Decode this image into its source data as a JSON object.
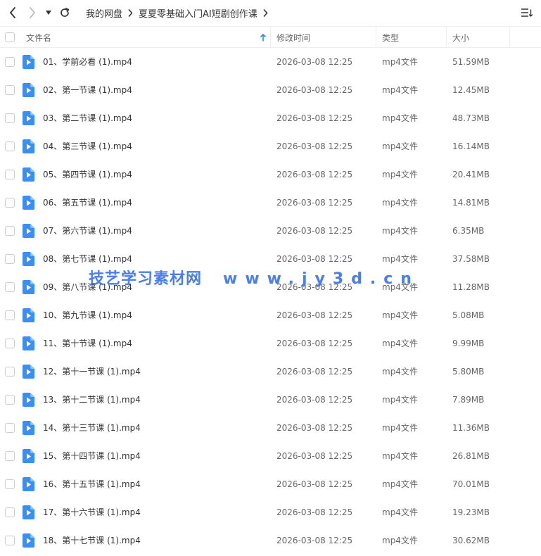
{
  "breadcrumb": {
    "items": [
      "我的网盘",
      "夏夏零基础入门AI短剧创作课"
    ]
  },
  "table": {
    "headers": {
      "name": "文件名",
      "modified": "修改时间",
      "type": "类型",
      "size": "大小"
    },
    "sort_icon": "sort-up-arrow-icon",
    "rows": [
      {
        "name": "01、学前必看 (1).mp4",
        "modified": "2026-03-08 12:25",
        "type": "mp4文件",
        "size": "51.59MB"
      },
      {
        "name": "02、第一节课 (1).mp4",
        "modified": "2026-03-08 12:25",
        "type": "mp4文件",
        "size": "12.45MB"
      },
      {
        "name": "03、第二节课 (1).mp4",
        "modified": "2026-03-08 12:25",
        "type": "mp4文件",
        "size": "48.73MB"
      },
      {
        "name": "04、第三节课 (1).mp4",
        "modified": "2026-03-08 12:25",
        "type": "mp4文件",
        "size": "16.14MB"
      },
      {
        "name": "05、第四节课 (1).mp4",
        "modified": "2026-03-08 12:25",
        "type": "mp4文件",
        "size": "20.41MB"
      },
      {
        "name": "06、第五节课 (1).mp4",
        "modified": "2026-03-08 12:25",
        "type": "mp4文件",
        "size": "14.81MB"
      },
      {
        "name": "07、第六节课 (1).mp4",
        "modified": "2026-03-08 12:25",
        "type": "mp4文件",
        "size": "6.35MB"
      },
      {
        "name": "08、第七节课 (1).mp4",
        "modified": "2026-03-08 12:25",
        "type": "mp4文件",
        "size": "37.58MB"
      },
      {
        "name": "09、第八节课 (1).mp4",
        "modified": "2026-03-08 12:25",
        "type": "mp4文件",
        "size": "11.28MB"
      },
      {
        "name": "10、第九节课 (1).mp4",
        "modified": "2026-03-08 12:25",
        "type": "mp4文件",
        "size": "5.08MB"
      },
      {
        "name": "11、第十节课 (1).mp4",
        "modified": "2026-03-08 12:25",
        "type": "mp4文件",
        "size": "9.99MB"
      },
      {
        "name": "12、第十一节课 (1).mp4",
        "modified": "2026-03-08 12:25",
        "type": "mp4文件",
        "size": "5.80MB"
      },
      {
        "name": "13、第十二节课 (1).mp4",
        "modified": "2026-03-08 12:25",
        "type": "mp4文件",
        "size": "7.89MB"
      },
      {
        "name": "14、第十三节课 (1).mp4",
        "modified": "2026-03-08 12:25",
        "type": "mp4文件",
        "size": "11.36MB"
      },
      {
        "name": "15、第十四节课 (1).mp4",
        "modified": "2026-03-08 12:25",
        "type": "mp4文件",
        "size": "26.81MB"
      },
      {
        "name": "16、第十五节课 (1).mp4",
        "modified": "2026-03-08 12:25",
        "type": "mp4文件",
        "size": "70.01MB"
      },
      {
        "name": "17、第十六节课 (1).mp4",
        "modified": "2026-03-08 12:25",
        "type": "mp4文件",
        "size": "19.23MB"
      },
      {
        "name": "18、第十七节课 (1).mp4",
        "modified": "2026-03-08 12:25",
        "type": "mp4文件",
        "size": "30.62MB"
      }
    ]
  },
  "watermark": {
    "brand": "技艺学习素材网",
    "url": "www.jy3d.cn"
  },
  "colors": {
    "accent": "#2f87f0",
    "file_icon": "#3a8ef6",
    "watermark": "#4a7df0",
    "divider": "#eceef1"
  },
  "icons": {
    "back": "chevron-left-icon",
    "forward": "chevron-right-icon",
    "dropdown": "caret-down-icon",
    "refresh": "refresh-icon",
    "view": "list-view-icon",
    "file": "video-file-icon"
  }
}
